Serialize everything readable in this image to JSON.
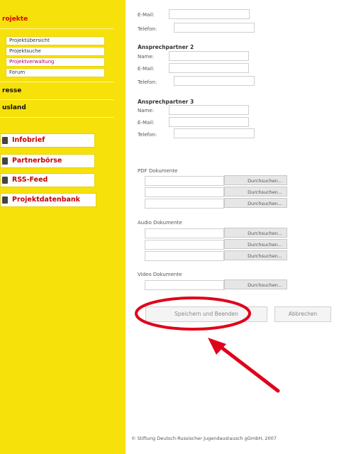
{
  "sidebar": {
    "projekte_heading": "rojekte",
    "subnav": [
      "Projektübersicht",
      "Projektsuche",
      "Projektverwaltung",
      "Forum"
    ],
    "presse": "resse",
    "ausland": "usland",
    "buttons": [
      "Infobrief",
      "Partnerbörse",
      "RSS-Feed",
      "Projektdatenbank"
    ]
  },
  "form": {
    "email_label": "E-Mail:",
    "telefon_label": "Telefon:",
    "partner2": {
      "title": "Ansprechpartner 2",
      "name_label": "Name:",
      "email_label": "E-Mail:",
      "telefon_label": "Telefon:"
    },
    "partner3": {
      "title": "Ansprechpartner 3",
      "name_label": "Name:",
      "email_label": "E-Mail:",
      "telefon_label": "Telefon:"
    },
    "pdf_label": "PDF Dokumente",
    "audio_label": "Audio Dokumente",
    "video_label": "Video Dokumente",
    "browse_label": "Durchsuchen...",
    "save_button": "Speichern und Beenden",
    "cancel_button": "Abbrechen"
  },
  "footer": "© Stiftung Deutsch-Russischer Jugendaustausch gGmbH, 2007",
  "colors": {
    "sidebar": "#f7e10b",
    "annotation": "#e0001b"
  }
}
